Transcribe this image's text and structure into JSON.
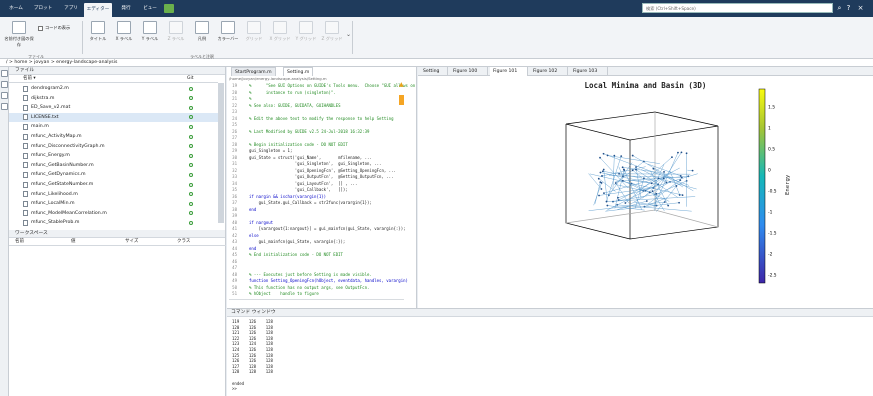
{
  "toolstrip": {
    "tabs": [
      "ホーム",
      "プロット",
      "アプリ",
      "エディター",
      "発行",
      "ビュー"
    ],
    "search_placeholder": "検索 (Ctrl+Shift+Space)"
  },
  "ribbon": {
    "buttons": [
      "名前付き図の保存",
      "コードの表示",
      "タイトル",
      "X ラベル",
      "Y ラベル",
      "Z ラベル",
      "凡例",
      "カラーバー",
      "グリッド",
      "X グリッド",
      "Y グリッド",
      "Z グリッド"
    ],
    "group_file": "ファイル",
    "group_labels": "ラベルと注釈"
  },
  "address": {
    "path": "/  >  home  >  jovyan  >  energy-landscape-analysis"
  },
  "files": {
    "panel_title": "ファイル",
    "col_name": "名前 ▾",
    "col_git": "Git",
    "items": [
      {
        "name": "dendrogram2.m",
        "sel": false
      },
      {
        "name": "dijkstra.m",
        "sel": false
      },
      {
        "name": "ED_Save_v2.mat",
        "sel": false
      },
      {
        "name": "LICENSE.txt",
        "sel": true
      },
      {
        "name": "main.m",
        "sel": false
      },
      {
        "name": "mfunc_ActivityMap.m",
        "sel": false
      },
      {
        "name": "mfunc_DisconnectivityGraph.m",
        "sel": false
      },
      {
        "name": "mfunc_Energy.m",
        "sel": false
      },
      {
        "name": "mfunc_GetBasinNumber.m",
        "sel": false
      },
      {
        "name": "mfunc_GetDynamics.m",
        "sel": false
      },
      {
        "name": "mfunc_GetStateNumber.m",
        "sel": false
      },
      {
        "name": "mfunc_Likelihood.m",
        "sel": false
      },
      {
        "name": "mfunc_LocalMin.m",
        "sel": false
      },
      {
        "name": "mfunc_ModelMeanCorrelation.m",
        "sel": false
      },
      {
        "name": "mfunc_StableProb.m",
        "sel": false
      }
    ]
  },
  "workspace": {
    "title": "ワークスペース",
    "cols": [
      "名前",
      "値",
      "サイズ",
      "クラス"
    ]
  },
  "editor": {
    "tabs": [
      "StartProgram.m",
      "Setting.m"
    ],
    "path": "/home/jovyan/energy-landscape-analysis/Setting.m",
    "lines": [
      {
        "n": "19",
        "t": "%      \"See GUI Options on GUIDE's Tools menu.  Choose \"GUI allows only one",
        "c": "cm"
      },
      {
        "n": "20",
        "t": "%      instance to run (singleton)\".",
        "c": "cm"
      },
      {
        "n": "21",
        "t": "%",
        "c": "cm"
      },
      {
        "n": "22",
        "t": "% See also: GUIDE, GUIDATA, GUIHANDLES",
        "c": "cm"
      },
      {
        "n": "23",
        "t": "",
        "c": ""
      },
      {
        "n": "24",
        "t": "% Edit the above text to modify the response to help Setting",
        "c": "cm"
      },
      {
        "n": "25",
        "t": "",
        "c": ""
      },
      {
        "n": "26",
        "t": "% Last Modified by GUIDE v2.5 24-Jul-2018 16:32:39",
        "c": "cm"
      },
      {
        "n": "27",
        "t": "",
        "c": ""
      },
      {
        "n": "28",
        "t": "% Begin initialization code - DO NOT EDIT",
        "c": "cm"
      },
      {
        "n": "29",
        "t": "gui_Singleton = 1;",
        "c": ""
      },
      {
        "n": "30",
        "t": "gui_State = struct('gui_Name',       mfilename, ...",
        "c": ""
      },
      {
        "n": "31",
        "t": "                   'gui_Singleton',  gui_Singleton, ...",
        "c": ""
      },
      {
        "n": "32",
        "t": "                   'gui_OpeningFcn', @Setting_OpeningFcn, ...",
        "c": ""
      },
      {
        "n": "33",
        "t": "                   'gui_OutputFcn',  @Setting_OutputFcn, ...",
        "c": ""
      },
      {
        "n": "34",
        "t": "                   'gui_LayoutFcn',  [] , ...",
        "c": ""
      },
      {
        "n": "35",
        "t": "                   'gui_Callback',   []);",
        "c": ""
      },
      {
        "n": "36",
        "t": "if nargin && ischar(varargin{1})",
        "c": "kw"
      },
      {
        "n": "37",
        "t": "    gui_State.gui_Callback = str2func(varargin{1});",
        "c": ""
      },
      {
        "n": "38",
        "t": "end",
        "c": "kw"
      },
      {
        "n": "39",
        "t": "",
        "c": ""
      },
      {
        "n": "40",
        "t": "if nargout",
        "c": "kw"
      },
      {
        "n": "41",
        "t": "    [varargout{1:nargout}] = gui_mainfcn(gui_State, varargin{:});",
        "c": ""
      },
      {
        "n": "42",
        "t": "else",
        "c": "kw"
      },
      {
        "n": "43",
        "t": "    gui_mainfcn(gui_State, varargin{:});",
        "c": ""
      },
      {
        "n": "44",
        "t": "end",
        "c": "kw"
      },
      {
        "n": "45",
        "t": "% End initialization code - DO NOT EDIT",
        "c": "cm"
      },
      {
        "n": "46",
        "t": "",
        "c": ""
      },
      {
        "n": "47",
        "t": "",
        "c": ""
      },
      {
        "n": "48",
        "t": "% --- Executes just before Setting is made visible.",
        "c": "cm"
      },
      {
        "n": "49",
        "t": "function Setting_OpeningFcn(hObject, eventdata, handles, varargin)",
        "c": "kw"
      },
      {
        "n": "50",
        "t": "% This function has no output args, see OutputFcn.",
        "c": "cm"
      },
      {
        "n": "51",
        "t": "% hObject    handle to figure",
        "c": "cm"
      }
    ]
  },
  "figure": {
    "tabs": [
      "Setting",
      "Figure 100",
      "Figure 101",
      "Figure 102",
      "Figure 103"
    ],
    "active_tab": 2,
    "plot_title": "Local Minima and Basin (3D)",
    "colorbar_label": "Energy",
    "colorbar_ticks": [
      "1.5",
      "1",
      "0.5",
      "0",
      "-0.5",
      "-1",
      "-1.5",
      "-2",
      "-2.5"
    ]
  },
  "command_window": {
    "title": "コマンド ウィンドウ",
    "lines": [
      "119    126    128",
      "120    126    128",
      "121    126    128",
      "122    126    128",
      "123    124    128",
      "124    126    128",
      "125    126    128",
      "126    126    128",
      "127    128    128",
      "128    128    128",
      "",
      "ended",
      ">>"
    ]
  }
}
